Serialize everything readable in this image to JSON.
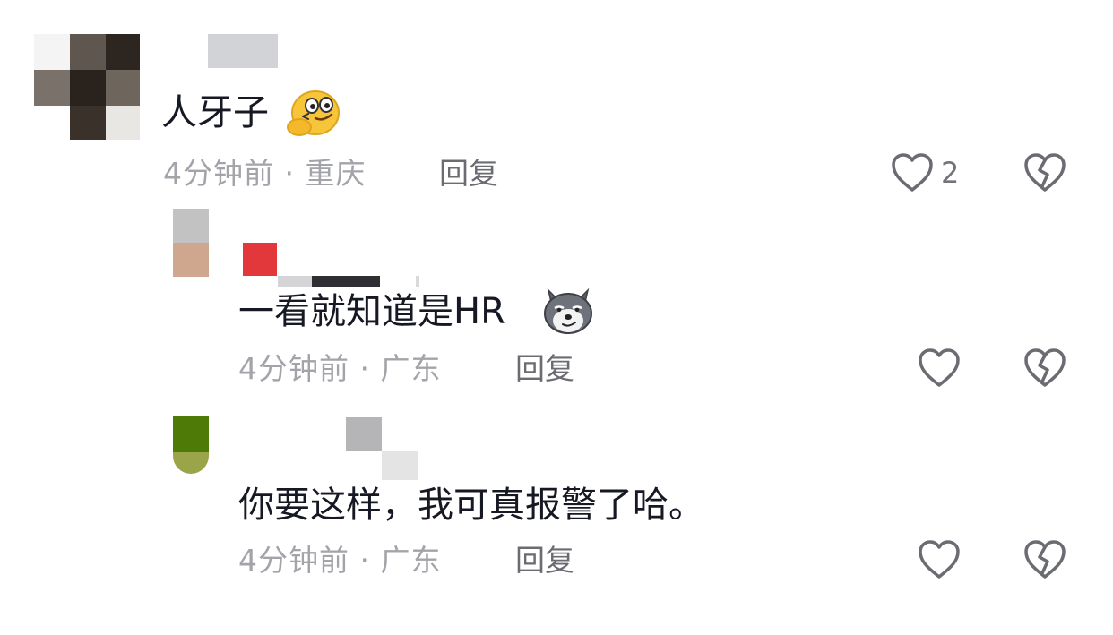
{
  "comments": [
    {
      "text": "人牙子",
      "emoji": "thinking-emoji",
      "time": "4分钟前",
      "location": "重庆",
      "reply_label": "回复",
      "like_count": "2"
    },
    {
      "text": "一看就知道是HR",
      "emoji": "dog-emoji",
      "time": "4分钟前",
      "location": "广东",
      "reply_label": "回复",
      "like_count": ""
    },
    {
      "text": "你要这样，我可真报警了哈。",
      "time": "4分钟前",
      "location": "广东",
      "reply_label": "回复",
      "like_count": ""
    }
  ],
  "separator": "·",
  "icons": {
    "like": "heart-outline-icon",
    "dislike": "broken-heart-icon"
  },
  "colors": {
    "text": "#161823",
    "meta": "#a3a4a9",
    "reply": "#6b6c72",
    "icon": "#6b6c72"
  }
}
